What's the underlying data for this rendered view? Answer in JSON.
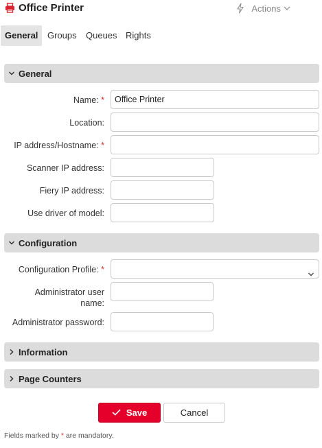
{
  "window": {
    "title": "Office Printer",
    "app_icon": "printer-icon",
    "actions_label": "Actions"
  },
  "tabs": [
    {
      "label": "General",
      "active": true
    },
    {
      "label": "Groups",
      "active": false
    },
    {
      "label": "Queues",
      "active": false
    },
    {
      "label": "Rights",
      "active": false
    }
  ],
  "sections": {
    "general": {
      "title": "General",
      "expanded": true,
      "fields": {
        "name": {
          "label": "Name:",
          "required": true,
          "value": "Office Printer"
        },
        "location": {
          "label": "Location:",
          "required": false,
          "value": ""
        },
        "ip_address": {
          "label": "IP address/Hostname:",
          "required": true,
          "value": ""
        },
        "scanner_ip": {
          "label": "Scanner IP address:",
          "required": false,
          "value": ""
        },
        "fiery_ip": {
          "label": "Fiery IP address:",
          "required": false,
          "value": ""
        },
        "driver_model": {
          "label": "Use driver of model:",
          "required": false,
          "value": ""
        }
      }
    },
    "configuration": {
      "title": "Configuration",
      "expanded": true,
      "fields": {
        "profile": {
          "label": "Configuration Profile:",
          "required": true,
          "value": ""
        },
        "admin_user_line1": "Administrator user",
        "admin_user_line2": "name:",
        "admin_password": {
          "label": "Administrator password:",
          "value": ""
        }
      }
    },
    "information": {
      "title": "Information",
      "expanded": false
    },
    "page_counters": {
      "title": "Page Counters",
      "expanded": false
    }
  },
  "buttons": {
    "save": "Save",
    "cancel": "Cancel"
  },
  "footnote": {
    "prefix": "Fields marked by ",
    "marker": "*",
    "suffix": " are mandatory."
  },
  "colors": {
    "accent": "#e4002b",
    "required": "#d32f2f",
    "section_bg": "#dcdcdc"
  }
}
